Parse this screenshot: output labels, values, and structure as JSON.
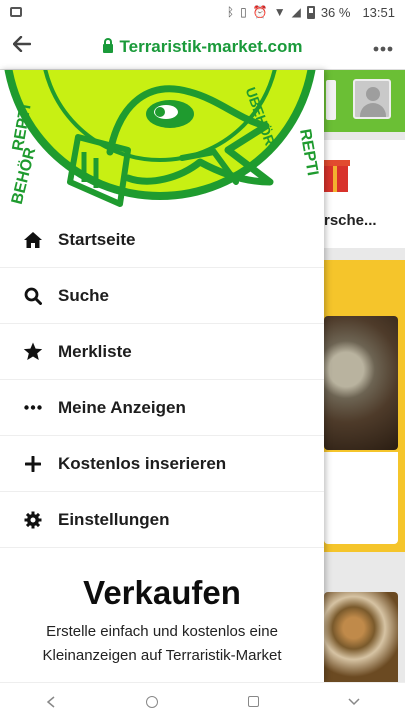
{
  "status_bar": {
    "battery_text": "36 %",
    "time": "13:51",
    "icons": [
      "image-icon",
      "bluetooth-icon",
      "vibrate-icon",
      "alarm-icon",
      "wifi-icon",
      "signal-icon",
      "battery-icon"
    ]
  },
  "browser": {
    "url": "Terraristik-market.com",
    "back_icon": "back-arrow-icon",
    "menu_icon": "more-dots-icon",
    "lock_icon": "lock-icon"
  },
  "background_page": {
    "card_text": "rsche...",
    "avatar_icon": "user-avatar-icon",
    "gift_icon": "gift-icon"
  },
  "drawer": {
    "logo_text_left": "REPTI",
    "logo_text_right": "REPTI",
    "logo_text_bottom_left": "BEHÖR",
    "logo_text_top_right": "UBEHÖR",
    "menu": [
      {
        "label": "Startseite",
        "icon": "home-icon"
      },
      {
        "label": "Suche",
        "icon": "search-icon"
      },
      {
        "label": "Merkliste",
        "icon": "star-icon"
      },
      {
        "label": "Meine Anzeigen",
        "icon": "dots-icon"
      },
      {
        "label": "Kostenlos inserieren",
        "icon": "plus-icon"
      },
      {
        "label": "Einstellungen",
        "icon": "gear-icon"
      }
    ],
    "verkaufen": {
      "title": "Verkaufen",
      "text": "Erstelle einfach und kostenlos eine Kleinanzeigen auf Terraristik-Market"
    }
  },
  "nav_bar": {
    "icons": [
      "nav-back-icon",
      "nav-home-icon",
      "nav-recents-icon",
      "nav-down-icon"
    ]
  },
  "colors": {
    "brand_green": "#1a9a3a",
    "logo_yellow": "#c8f013",
    "logo_green": "#2aa83a",
    "header_green": "#6bbf35",
    "accent_yellow": "#f5c52b"
  }
}
